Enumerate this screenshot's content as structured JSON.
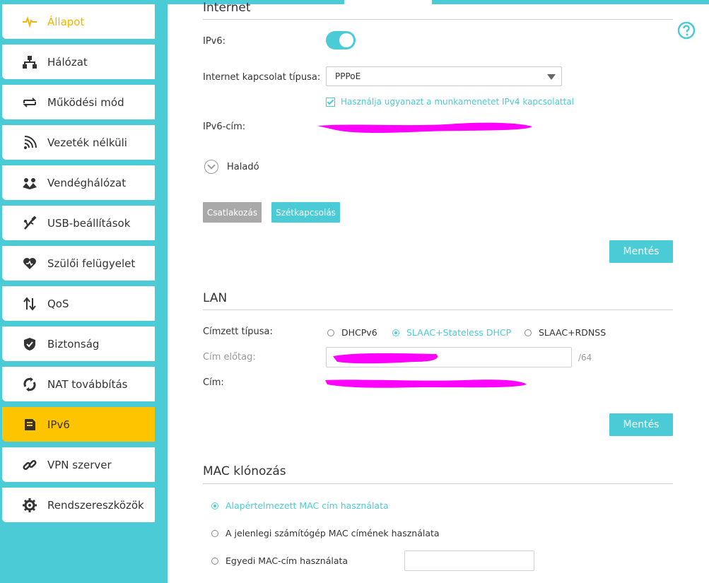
{
  "sidebar": {
    "items": [
      {
        "label": "Állapot",
        "icon": "activity-icon",
        "name": "sidebar-item-allapot"
      },
      {
        "label": "Hálózat",
        "icon": "network-icon",
        "name": "sidebar-item-halozat"
      },
      {
        "label": "Működési mód",
        "icon": "mode-switch-icon",
        "name": "sidebar-item-mukodesi-mod"
      },
      {
        "label": "Vezeték nélküli",
        "icon": "wifi-icon",
        "name": "sidebar-item-vezetek-nelkuli"
      },
      {
        "label": "Vendéghálózat",
        "icon": "guest-network-icon",
        "name": "sidebar-item-vendeghalozat"
      },
      {
        "label": "USB-beállítások",
        "icon": "usb-icon",
        "name": "sidebar-item-usb-beallitasok"
      },
      {
        "label": "Szülői felügyelet",
        "icon": "heart-icon",
        "name": "sidebar-item-szuloi-felugyelet"
      },
      {
        "label": "QoS",
        "icon": "qos-arrows-icon",
        "name": "sidebar-item-qos"
      },
      {
        "label": "Biztonság",
        "icon": "shield-icon",
        "name": "sidebar-item-biztonsag"
      },
      {
        "label": "NAT továbbítás",
        "icon": "nat-forwarding-icon",
        "name": "sidebar-item-nat-tovabbitas"
      },
      {
        "label": "IPv6",
        "icon": "ipv6-document-icon",
        "name": "sidebar-item-ipv6"
      },
      {
        "label": "VPN szerver",
        "icon": "vpn-link-icon",
        "name": "sidebar-item-vpn-szerver"
      },
      {
        "label": "Rendszereszközök",
        "icon": "gear-icon",
        "name": "sidebar-item-rendszereszkozok"
      }
    ],
    "status_color": "#f5b400",
    "selected_color": "#ffc400"
  },
  "internet": {
    "title": "Internet",
    "ipv6_label": "IPv6:",
    "ipv6_enabled": true,
    "connection_type_label": "Internet kapcsolat típusa:",
    "connection_type_value": "PPPoE",
    "same_session_checkbox": "Használja ugyanazt a munkamenetet IPv4 kapcsolattal",
    "same_session_checked": true,
    "ipv6_address_label": "IPv6-cím:",
    "advanced_label": "Haladó",
    "connect_button": "Csatlakozás",
    "disconnect_button": "Szétkapcsolás",
    "save_button": "Mentés"
  },
  "lan": {
    "title": "LAN",
    "address_type_label": "Címzett típusa:",
    "address_type_options": [
      "DHCPv6",
      "SLAAC+Stateless DHCP",
      "SLAAC+RDNSS"
    ],
    "address_type_selected": "SLAAC+Stateless DHCP",
    "prefix_label": "Cím előtag:",
    "prefix_suffix": "/64",
    "address_label": "Cím:",
    "save_button": "Mentés"
  },
  "mac_clone": {
    "title": "MAC klónozás",
    "options": [
      "Alapértelmezett MAC cím használata",
      "A jelenlegi számítógép MAC címének használata",
      "Egyedi MAC-cím használata"
    ],
    "selected": "Alapértelmezett MAC cím használata"
  },
  "colors": {
    "accent": "#4acbd6",
    "redaction": "#ff00ff"
  }
}
